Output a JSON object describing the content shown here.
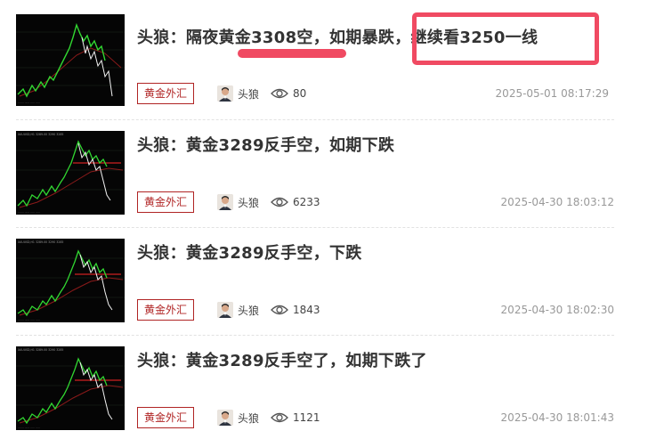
{
  "articles": [
    {
      "title": "头狼：隔夜黄金3308空，如期暴跌，继续看3250一线",
      "tag": "黄金外汇",
      "author": "头狼",
      "views": "80",
      "date": "2025-05-01 08:17:29"
    },
    {
      "title": "头狼：黄金3289反手空，如期下跌",
      "tag": "黄金外汇",
      "author": "头狼",
      "views": "6233",
      "date": "2025-04-30 18:03:12"
    },
    {
      "title": "头狼：黄金3289反手空，下跌",
      "tag": "黄金外汇",
      "author": "头狼",
      "views": "1843",
      "date": "2025-04-30 18:02:30"
    },
    {
      "title": "头狼：黄金3289反手空了，如期下跌了",
      "tag": "黄金外汇",
      "author": "头狼",
      "views": "1121",
      "date": "2025-04-30 18:01:43"
    }
  ],
  "icons": {
    "views": "eye-icon",
    "avatar": "author-avatar"
  },
  "colors": {
    "tag_border": "#b02424",
    "annotation": "#f04a62",
    "title": "#333333",
    "date": "#999999"
  }
}
